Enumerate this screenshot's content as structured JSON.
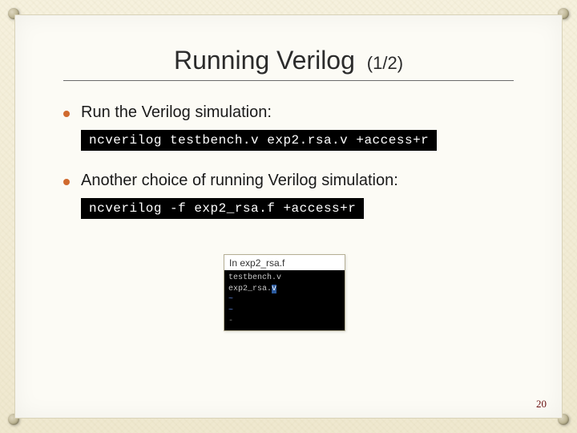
{
  "title": {
    "main": "Running Verilog",
    "sub": "(1/2)"
  },
  "bullets": [
    {
      "text": "Run the Verilog simulation:"
    },
    {
      "text": "Another choice of running Verilog simulation:"
    }
  ],
  "code": [
    "ncverilog testbench.v exp2.rsa.v +access+r",
    "ncverilog -f exp2_rsa.f +access+r"
  ],
  "filebox": {
    "header": "In exp2_rsa.f",
    "lines": [
      "testbench.v",
      "exp2_rsa.",
      "v",
      "~",
      "~",
      "-"
    ]
  },
  "page_number": "20"
}
